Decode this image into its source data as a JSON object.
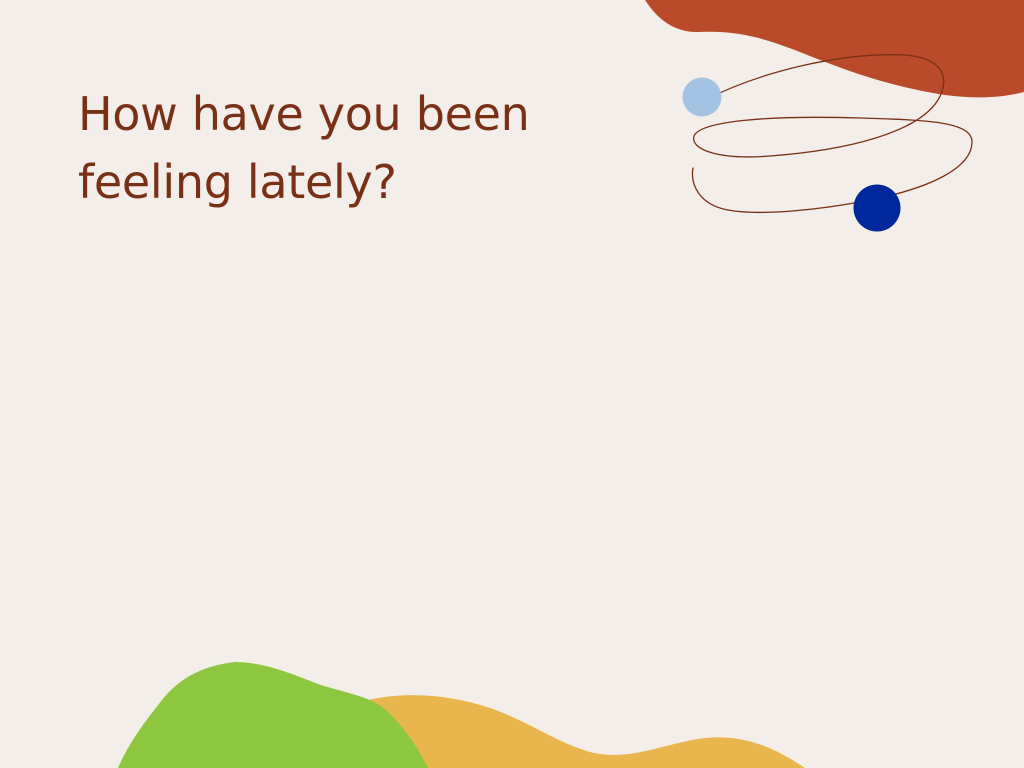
{
  "slide": {
    "question_line_1": "How have you been",
    "question_line_2": "feeling lately?"
  },
  "colors": {
    "background": "#F3EEE9",
    "text": "#7A3014",
    "rust_blob": "#B94A2A",
    "light_blue_dot": "#A4C3E3",
    "navy_dot": "#00279B",
    "squiggle_line": "#7A3014",
    "green_blob": "#8DC63F",
    "yellow_blob": "#E8B64C"
  },
  "icons": [
    "rust-blob-shape",
    "squiggle-line",
    "light-blue-dot",
    "navy-dot",
    "green-blob-shape",
    "yellow-blob-shape"
  ]
}
